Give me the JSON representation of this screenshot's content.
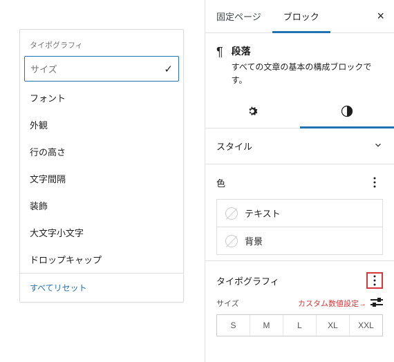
{
  "dropdown": {
    "header": "タイポグラフィ",
    "items": [
      {
        "label": "サイズ",
        "selected": true
      },
      {
        "label": "フォント",
        "selected": false
      },
      {
        "label": "外観",
        "selected": false
      },
      {
        "label": "行の高さ",
        "selected": false
      },
      {
        "label": "文字間隔",
        "selected": false
      },
      {
        "label": "装飾",
        "selected": false
      },
      {
        "label": "大文字小文字",
        "selected": false
      },
      {
        "label": "ドロップキャップ",
        "selected": false
      }
    ],
    "reset": "すべてリセット"
  },
  "sidebar": {
    "tabs": {
      "page": "固定ページ",
      "block": "ブロック"
    },
    "block": {
      "title": "段落",
      "desc": "すべての文章の基本の構成ブロックです。"
    },
    "style_panel": "スタイル",
    "color": {
      "title": "色",
      "text": "テキスト",
      "background": "背景"
    },
    "typography": {
      "title": "タイポグラフィ",
      "size_label": "サイズ",
      "custom_note": "カスタム数値設定→",
      "sizes": [
        "S",
        "M",
        "L",
        "XL",
        "XXL"
      ]
    }
  }
}
